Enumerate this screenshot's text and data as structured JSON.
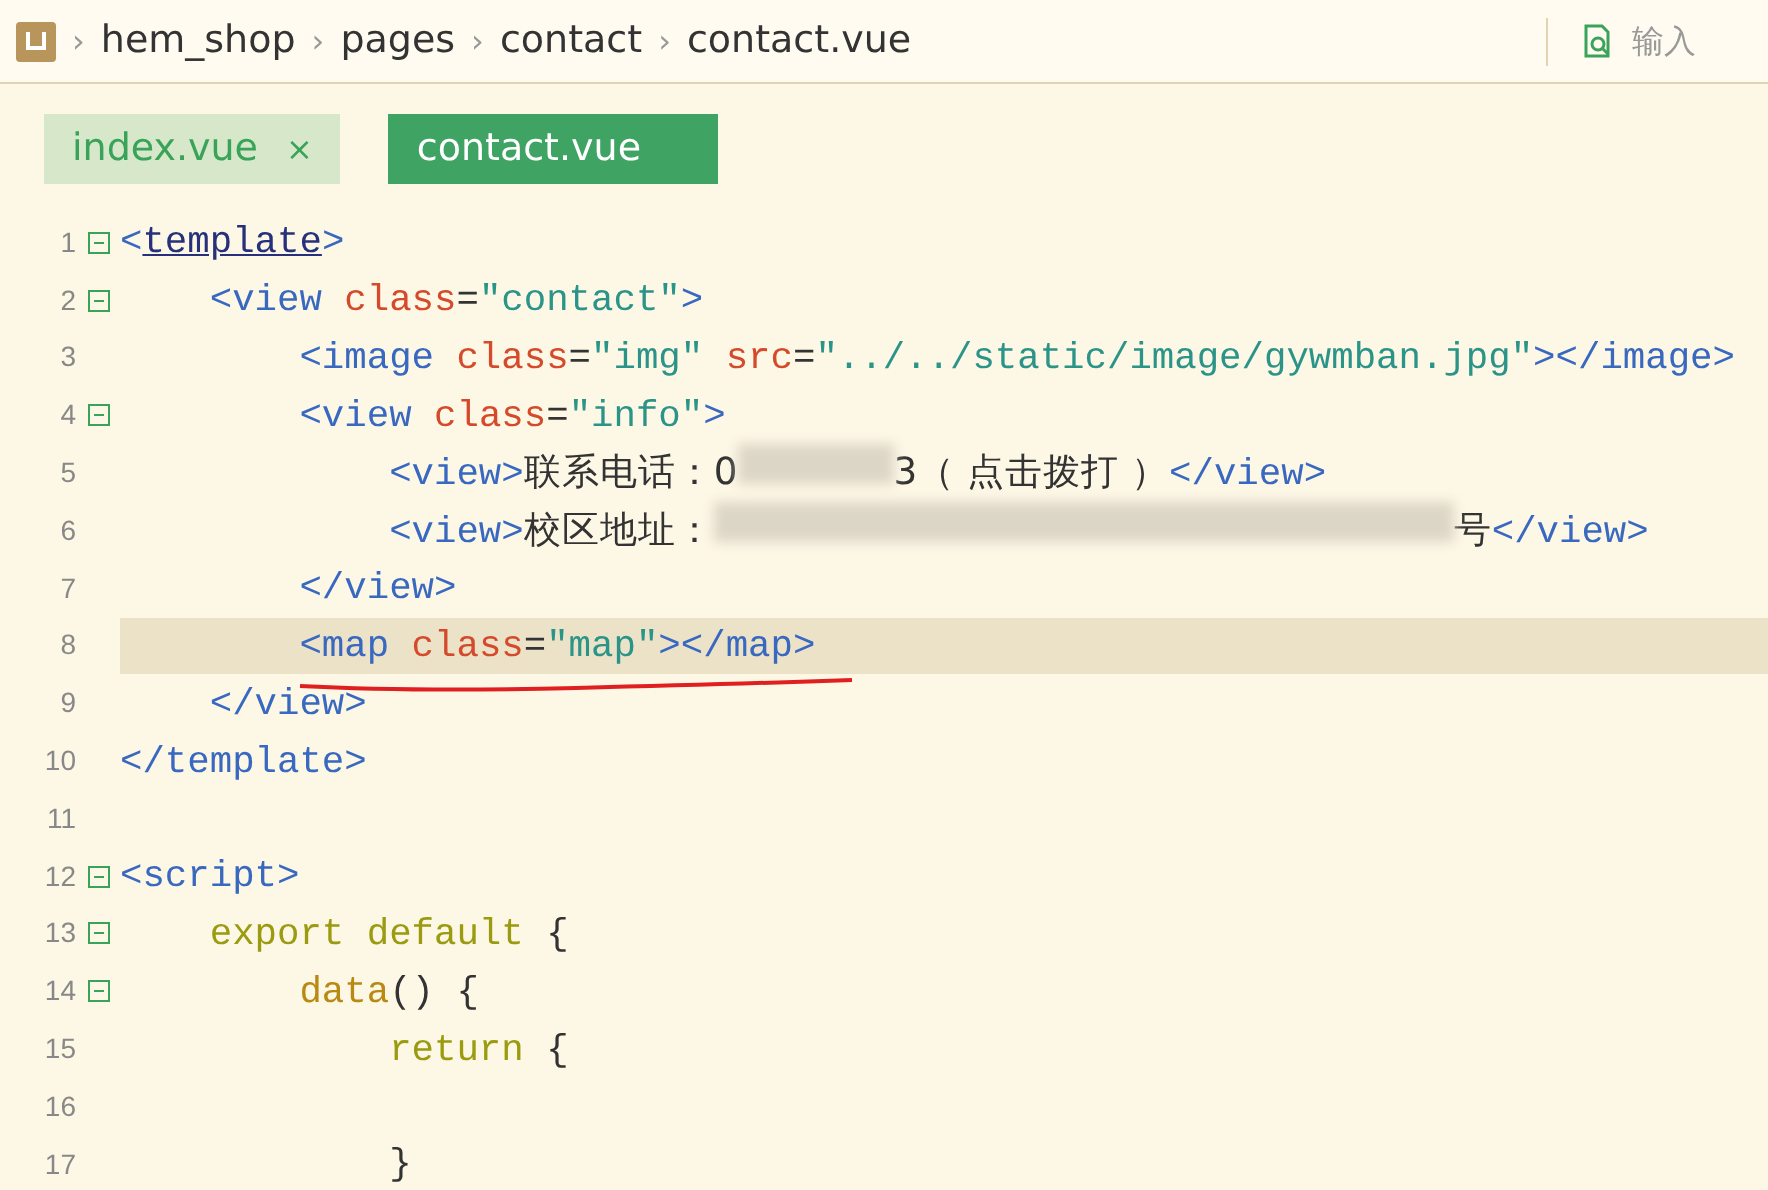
{
  "breadcrumb": {
    "separator": "›",
    "items": [
      "hem_shop",
      "pages",
      "contact",
      "contact.vue"
    ]
  },
  "search": {
    "placeholder": "输入"
  },
  "tabs": [
    {
      "label": "index.vue",
      "selected": false,
      "close": "×"
    },
    {
      "label": "contact.vue",
      "selected": true
    }
  ],
  "code_lines": [
    {
      "number": "1",
      "foldable": true,
      "current": false,
      "tokens": [
        {
          "kind": "tag",
          "text": "<"
        },
        {
          "kind": "link",
          "text": "template"
        },
        {
          "kind": "tag",
          "text": ">"
        }
      ]
    },
    {
      "number": "2",
      "foldable": true,
      "current": false,
      "tokens": [
        {
          "kind": "tag",
          "text": "    <view "
        },
        {
          "kind": "attr",
          "text": "class"
        },
        {
          "kind": "plain",
          "text": "="
        },
        {
          "kind": "str",
          "text": "\"contact\""
        },
        {
          "kind": "tag",
          "text": ">"
        }
      ]
    },
    {
      "number": "3",
      "foldable": false,
      "current": false,
      "tokens": [
        {
          "kind": "tag",
          "text": "        <image "
        },
        {
          "kind": "attr",
          "text": "class"
        },
        {
          "kind": "plain",
          "text": "="
        },
        {
          "kind": "str",
          "text": "\"img\" "
        },
        {
          "kind": "attr",
          "text": "src"
        },
        {
          "kind": "plain",
          "text": "="
        },
        {
          "kind": "str",
          "text": "\"../../static/image/gywmban.jpg\""
        },
        {
          "kind": "tag",
          "text": "></image>"
        }
      ]
    },
    {
      "number": "4",
      "foldable": true,
      "current": false,
      "tokens": [
        {
          "kind": "tag",
          "text": "        <view "
        },
        {
          "kind": "attr",
          "text": "class"
        },
        {
          "kind": "plain",
          "text": "="
        },
        {
          "kind": "str",
          "text": "\"info\""
        },
        {
          "kind": "tag",
          "text": ">"
        }
      ]
    },
    {
      "number": "5",
      "foldable": false,
      "current": false,
      "tokens": [
        {
          "kind": "tag",
          "text": "            <view>"
        },
        {
          "kind": "plain",
          "text": "联系电话：0"
        },
        {
          "kind": "redacted"
        },
        {
          "kind": "plain",
          "text": "3（ 点击拨打 ）"
        },
        {
          "kind": "tag",
          "text": "</view>"
        }
      ]
    },
    {
      "number": "6",
      "foldable": false,
      "current": false,
      "tokens": [
        {
          "kind": "tag",
          "text": "            <view>"
        },
        {
          "kind": "plain",
          "text": "校区地址："
        },
        {
          "kind": "redacted"
        },
        {
          "kind": "plain",
          "text": "号"
        },
        {
          "kind": "tag",
          "text": "</view>"
        }
      ]
    },
    {
      "number": "7",
      "foldable": false,
      "current": false,
      "tokens": [
        {
          "kind": "tag",
          "text": "        </view>"
        }
      ]
    },
    {
      "number": "8",
      "foldable": false,
      "current": true,
      "tokens": [
        {
          "kind": "tag",
          "text": "        <map "
        },
        {
          "kind": "attr",
          "text": "class"
        },
        {
          "kind": "plain",
          "text": "="
        },
        {
          "kind": "str",
          "text": "\"map\""
        },
        {
          "kind": "tag",
          "text": "></map>"
        }
      ]
    },
    {
      "number": "9",
      "foldable": false,
      "current": false,
      "tokens": [
        {
          "kind": "tag",
          "text": "    </view>"
        }
      ]
    },
    {
      "number": "10",
      "foldable": false,
      "current": false,
      "tokens": [
        {
          "kind": "tag",
          "text": "</template>"
        }
      ]
    },
    {
      "number": "11",
      "foldable": false,
      "current": false
    },
    {
      "number": "12",
      "foldable": true,
      "current": false,
      "tokens": [
        {
          "kind": "tag",
          "text": "<script>"
        }
      ]
    },
    {
      "number": "13",
      "foldable": true,
      "current": false,
      "tokens": [
        {
          "kind": "kw",
          "text": "    export default"
        },
        {
          "kind": "plain",
          "text": " {"
        }
      ]
    },
    {
      "number": "14",
      "foldable": true,
      "current": false,
      "tokens": [
        {
          "kind": "fn",
          "text": "        data"
        },
        {
          "kind": "plain",
          "text": "() {"
        }
      ]
    },
    {
      "number": "15",
      "foldable": false,
      "current": false,
      "tokens": [
        {
          "kind": "kw",
          "text": "            return"
        },
        {
          "kind": "plain",
          "text": " {"
        }
      ]
    },
    {
      "number": "16",
      "foldable": false,
      "current": false
    },
    {
      "number": "17",
      "foldable": false,
      "current": false,
      "tokens": [
        {
          "kind": "plain",
          "text": "            }"
        }
      ]
    }
  ]
}
